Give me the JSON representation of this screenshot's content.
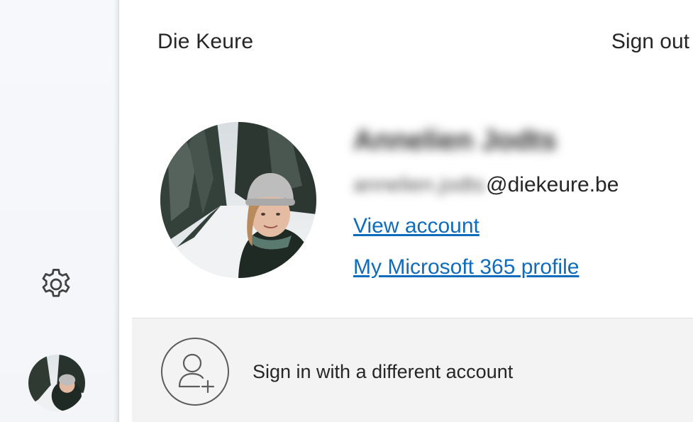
{
  "account_panel": {
    "organization": "Die Keure",
    "sign_out_label": "Sign out",
    "user_display_name": "Annelien Jodts",
    "email_local_part": "annelien.jodts",
    "email_domain": "@diekeure.be",
    "view_account_label": "View account",
    "profile_link_label": "My Microsoft 365 profile",
    "link_color": "#0f6cbd"
  },
  "footer": {
    "sign_in_other_label": "Sign in with a different account",
    "icon": "add-person-icon"
  },
  "left_rail": {
    "settings_icon": "gear-icon",
    "avatar": "user-avatar"
  }
}
